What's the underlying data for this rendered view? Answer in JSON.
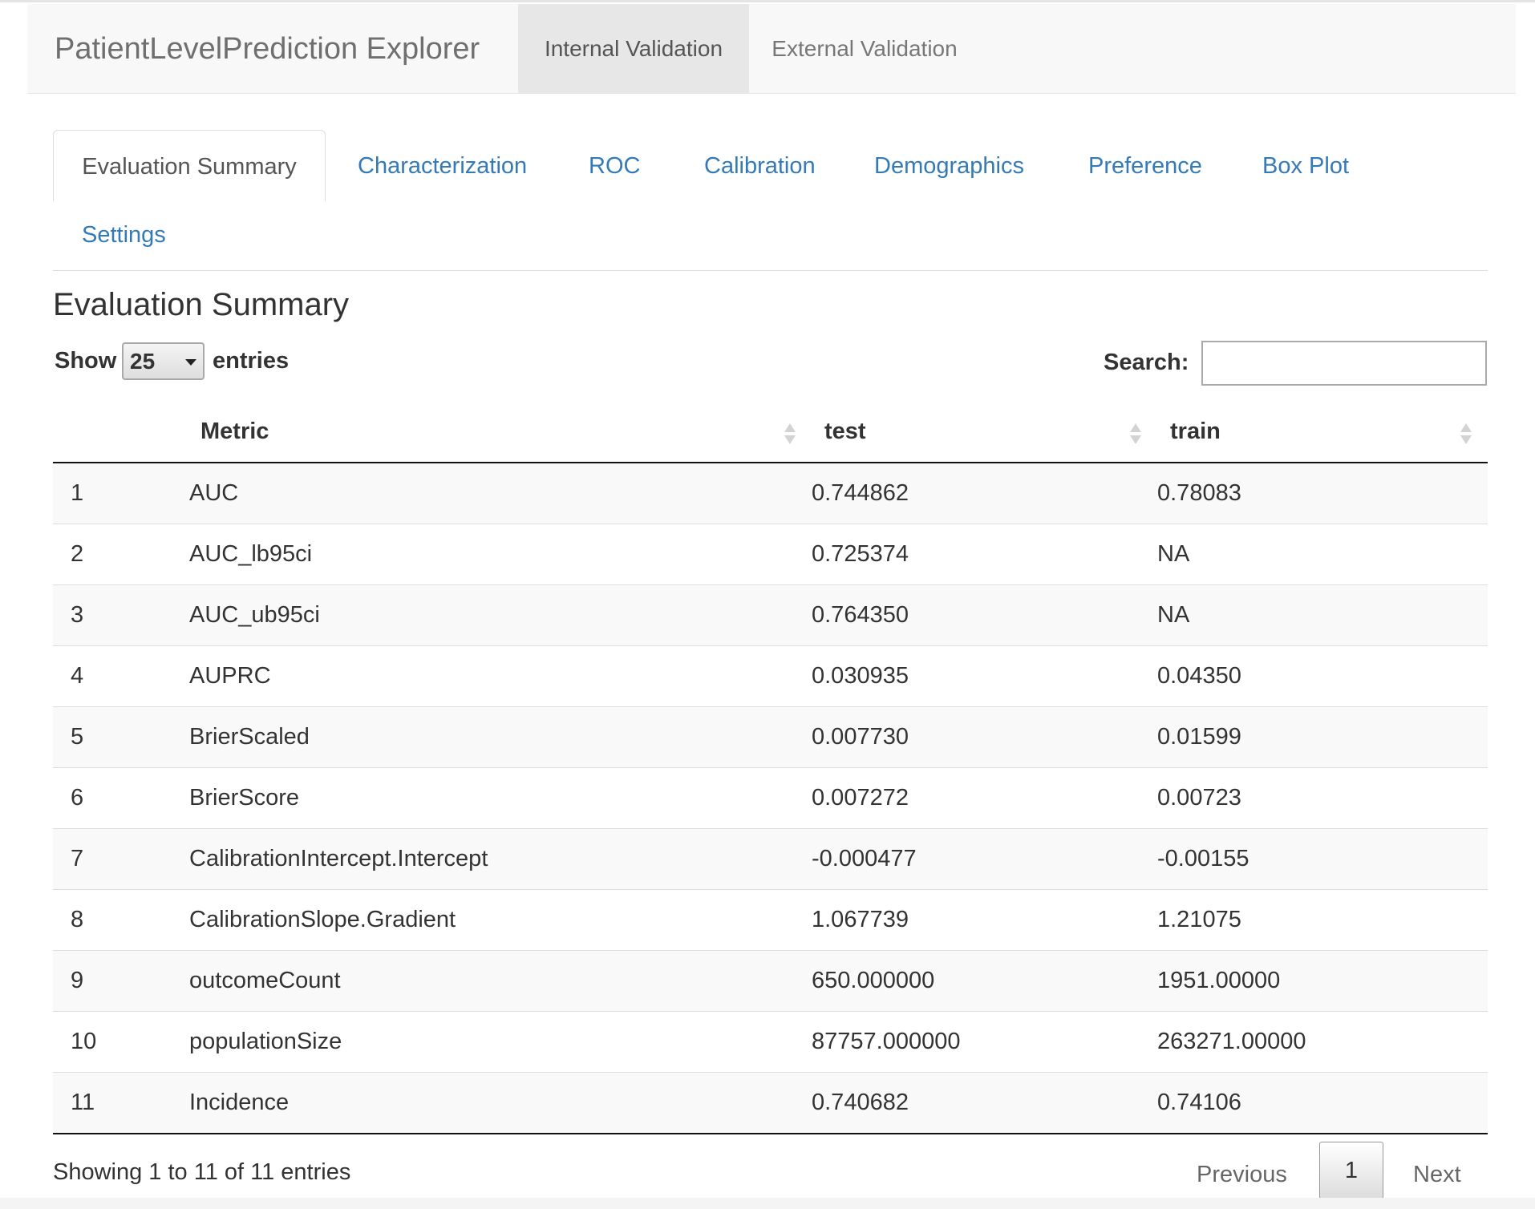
{
  "navbar": {
    "brand": "PatientLevelPrediction Explorer",
    "tabs": [
      {
        "label": "Internal Validation",
        "active": true
      },
      {
        "label": "External Validation",
        "active": false
      }
    ]
  },
  "tabs": [
    {
      "label": "Evaluation Summary",
      "active": true
    },
    {
      "label": "Characterization",
      "active": false
    },
    {
      "label": "ROC",
      "active": false
    },
    {
      "label": "Calibration",
      "active": false
    },
    {
      "label": "Demographics",
      "active": false
    },
    {
      "label": "Preference",
      "active": false
    },
    {
      "label": "Box Plot",
      "active": false
    },
    {
      "label": "Settings",
      "active": false
    }
  ],
  "section_title": "Evaluation Summary",
  "length_menu": {
    "show_label": "Show",
    "value": "25",
    "entries_label": "entries"
  },
  "search": {
    "label": "Search:",
    "value": ""
  },
  "table": {
    "headers": [
      "",
      "Metric",
      "test",
      "train"
    ],
    "rows": [
      [
        "1",
        "AUC",
        "0.744862",
        "0.78083"
      ],
      [
        "2",
        "AUC_lb95ci",
        "0.725374",
        "NA"
      ],
      [
        "3",
        "AUC_ub95ci",
        "0.764350",
        "NA"
      ],
      [
        "4",
        "AUPRC",
        "0.030935",
        "0.04350"
      ],
      [
        "5",
        "BrierScaled",
        "0.007730",
        "0.01599"
      ],
      [
        "6",
        "BrierScore",
        "0.007272",
        "0.00723"
      ],
      [
        "7",
        "CalibrationIntercept.Intercept",
        "-0.000477",
        "-0.00155"
      ],
      [
        "8",
        "CalibrationSlope.Gradient",
        "1.067739",
        "1.21075"
      ],
      [
        "9",
        "outcomeCount",
        "650.000000",
        "1951.00000"
      ],
      [
        "10",
        "populationSize",
        "87757.000000",
        "263271.00000"
      ],
      [
        "11",
        "Incidence",
        "0.740682",
        "0.74106"
      ]
    ]
  },
  "info": "Showing 1 to 11 of 11 entries",
  "pagination": {
    "previous": "Previous",
    "current": "1",
    "next": "Next"
  }
}
